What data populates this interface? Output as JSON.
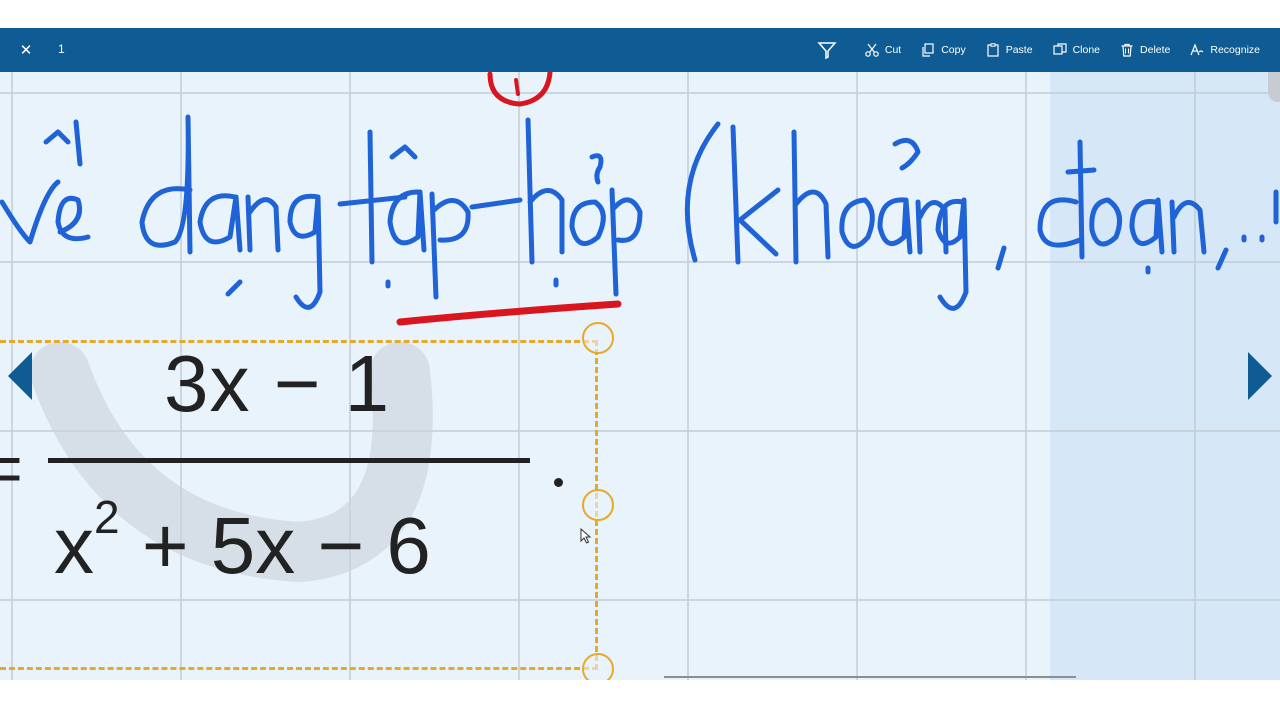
{
  "toolbar": {
    "selection_count": "1",
    "actions": {
      "lasso": "lasso-icon",
      "cut": "Cut",
      "copy": "Copy",
      "paste": "Paste",
      "clone": "Clone",
      "delete": "Delete",
      "recognize": "Recognize"
    }
  },
  "canvas": {
    "selected_formula": {
      "numerator": "3x − 1",
      "denominator_base": "x",
      "denominator_exponent": "2",
      "denominator_rest": " + 5x − 6"
    }
  },
  "colors": {
    "toolbar_bg": "#0f5b93",
    "canvas_bg": "#e9f3fb",
    "ink_blue": "#1f63d6",
    "ink_red": "#d9151f",
    "selection": "#e6a92a"
  }
}
